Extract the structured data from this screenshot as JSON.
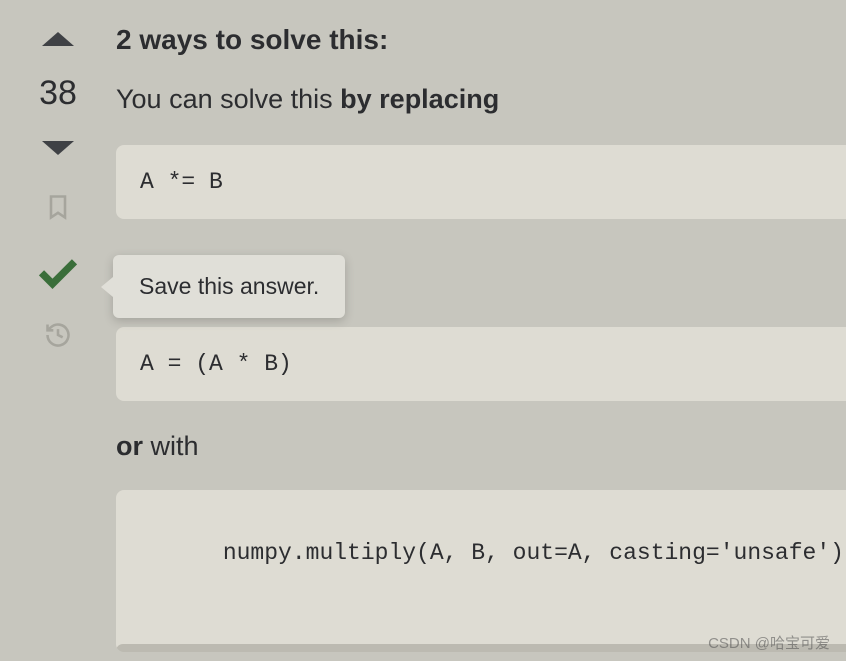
{
  "vote": {
    "count": "38"
  },
  "tooltip": {
    "text": "Save this answer."
  },
  "content": {
    "heading": "2 ways to solve this:",
    "intro_prefix": "You can solve this ",
    "intro_bold": "by replacing",
    "code1": "A *= B",
    "code2": "A = (A * B)",
    "or_bold": "or",
    "or_rest": " with",
    "code3": "numpy.multiply(A, B, out=A, casting='unsafe')"
  },
  "watermark": "CSDN @哈宝可爱"
}
